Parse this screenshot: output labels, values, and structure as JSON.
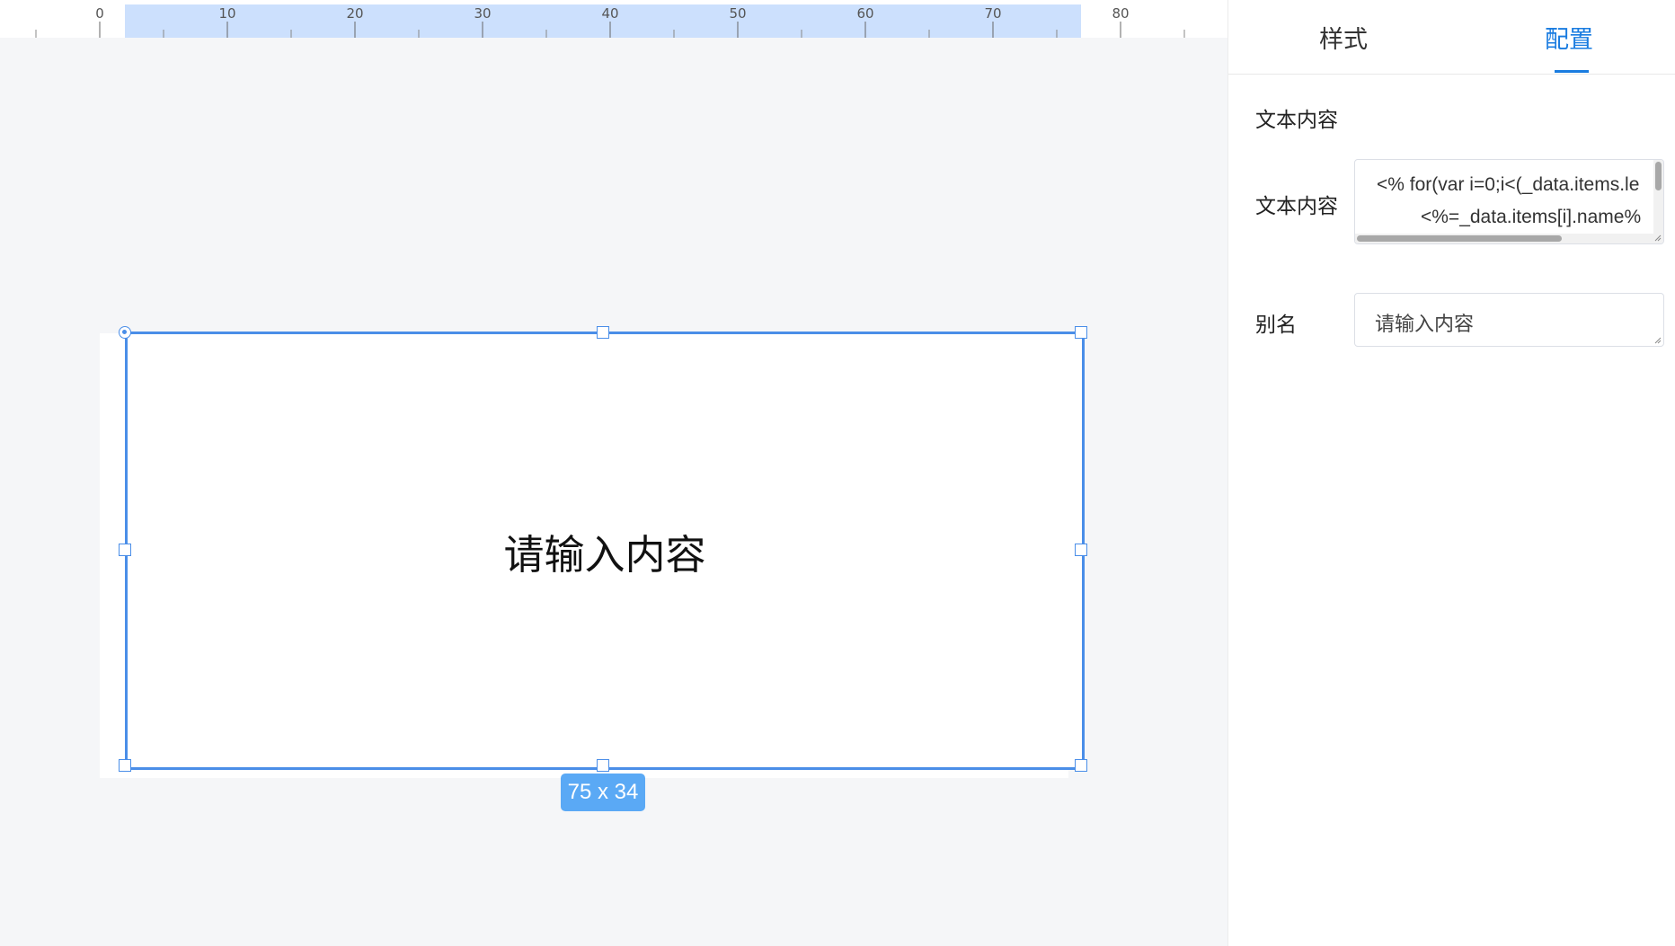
{
  "ruler": {
    "ticks": [
      "0",
      "10",
      "20",
      "30",
      "40",
      "50",
      "60",
      "70",
      "80"
    ]
  },
  "canvas": {
    "component_text": "请输入内容",
    "size_badge": "75 x 34"
  },
  "panel": {
    "tabs": [
      {
        "label": "样式",
        "active": false
      },
      {
        "label": "配置",
        "active": true
      }
    ],
    "section_title": "文本内容",
    "text_content": {
      "label": "文本内容",
      "line1": "<% for(var i=0;i<(_data.items.le",
      "line2": "<%=_data.items[i].name%"
    },
    "alias": {
      "label": "别名",
      "value": "请输入内容"
    }
  },
  "colors": {
    "accent": "#1a7ce0",
    "selection": "#4a8ee8",
    "badge": "#5aa9f5",
    "ruler_highlight": "#cce0fd"
  }
}
